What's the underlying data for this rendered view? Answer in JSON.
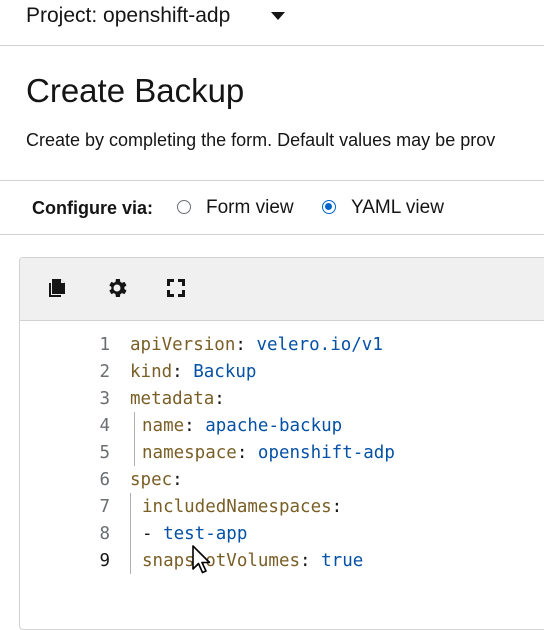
{
  "project": {
    "label": "Project: openshift-adp"
  },
  "page": {
    "title": "Create Backup",
    "description": "Create by completing the form. Default values may be prov"
  },
  "configure": {
    "label": "Configure via:",
    "options": [
      {
        "label": "Form view",
        "selected": false
      },
      {
        "label": "YAML view",
        "selected": true
      }
    ]
  },
  "editor": {
    "toolbar_icons": [
      "copy-icon",
      "gear-icon",
      "expand-icon"
    ],
    "active_line": 9,
    "lines": [
      {
        "n": "1",
        "key": "apiVersion",
        "sep": ": ",
        "val": "velero.io/v1"
      },
      {
        "n": "2",
        "key": "kind",
        "sep": ": ",
        "val": "Backup"
      },
      {
        "n": "3",
        "key": "metadata",
        "sep": ":",
        "val": ""
      },
      {
        "n": "4",
        "key": "name",
        "sep": ": ",
        "val": "apache-backup"
      },
      {
        "n": "5",
        "key": "namespace",
        "sep": ": ",
        "val": "openshift-adp"
      },
      {
        "n": "6",
        "key": "spec",
        "sep": ":",
        "val": ""
      },
      {
        "n": "7",
        "key": "includedNamespaces",
        "sep": ":",
        "val": ""
      },
      {
        "n": "8",
        "key": "- ",
        "sep": "",
        "val": "test-app"
      },
      {
        "n": "9",
        "key": "snapshotVolumes",
        "sep": ": ",
        "val": "true"
      }
    ]
  },
  "colors": {
    "accent": "#0066cc",
    "key": "#795e26",
    "value": "#0451a5"
  }
}
